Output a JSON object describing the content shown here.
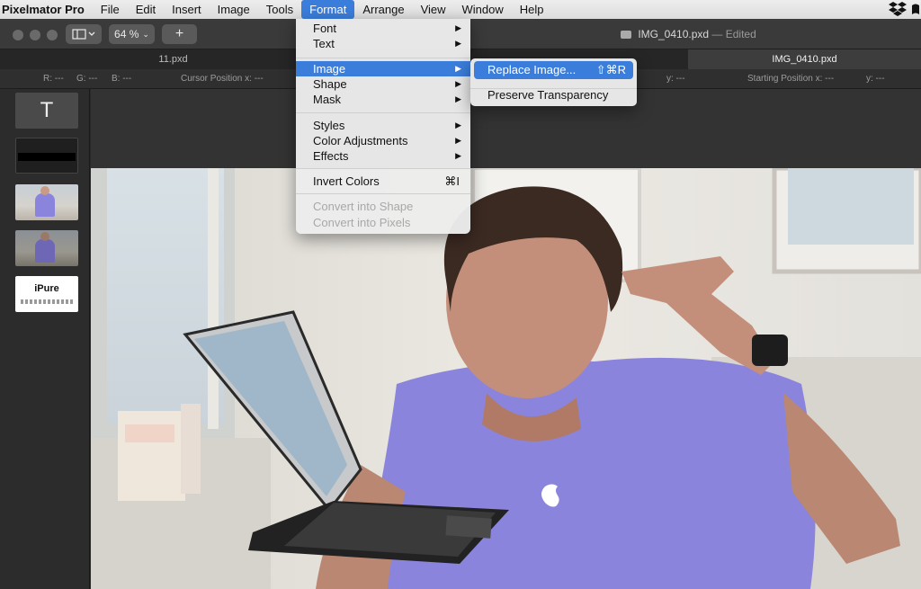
{
  "menubar": {
    "app": "Pixelmator Pro",
    "items": [
      "File",
      "Edit",
      "Insert",
      "Image",
      "Tools",
      "Format",
      "Arrange",
      "View",
      "Window",
      "Help"
    ],
    "active": "Format",
    "right_icon": "dropbox-icon"
  },
  "toolbar": {
    "zoom": "64 %",
    "add_label": "+",
    "doc_name": "IMG_0410.pxd",
    "doc_status": "— Edited"
  },
  "tabs": [
    "11.pxd",
    "IMG_0410.pxd"
  ],
  "infobar": {
    "r": "R: ---",
    "g": "G: ---",
    "b": "B: ---",
    "cursor_x": "Cursor Position x: ---",
    "cursor_y": "y: ---",
    "start_x": "Starting Position x: ---",
    "start_y": "y: ---"
  },
  "sidebar": {
    "layers": [
      {
        "name": "text-layer",
        "glyph": "T"
      },
      {
        "name": "shape-layer"
      },
      {
        "name": "photo-layer-1"
      },
      {
        "name": "photo-layer-2"
      },
      {
        "name": "ipure-layer",
        "label": "iPure"
      }
    ]
  },
  "format_menu": {
    "items": [
      {
        "label": "Font",
        "submenu": true
      },
      {
        "label": "Text",
        "submenu": true
      },
      {
        "label": "Image",
        "submenu": true,
        "highlighted": true
      },
      {
        "label": "Shape",
        "submenu": true
      },
      {
        "label": "Mask",
        "submenu": true
      },
      {
        "label": "Styles",
        "submenu": true
      },
      {
        "label": "Color Adjustments",
        "submenu": true
      },
      {
        "label": "Effects",
        "submenu": true
      },
      {
        "label": "Invert Colors",
        "shortcut": "⌘I"
      },
      {
        "label": "Convert into Shape",
        "disabled": true
      },
      {
        "label": "Convert into Pixels",
        "disabled": true
      }
    ]
  },
  "image_submenu": {
    "items": [
      {
        "label": "Replace Image...",
        "shortcut": "⇧⌘R",
        "highlighted": true
      },
      {
        "label": "Preserve Transparency"
      }
    ]
  },
  "colors": {
    "accent": "#3b7ddb",
    "shirt": "#8b84dd"
  }
}
